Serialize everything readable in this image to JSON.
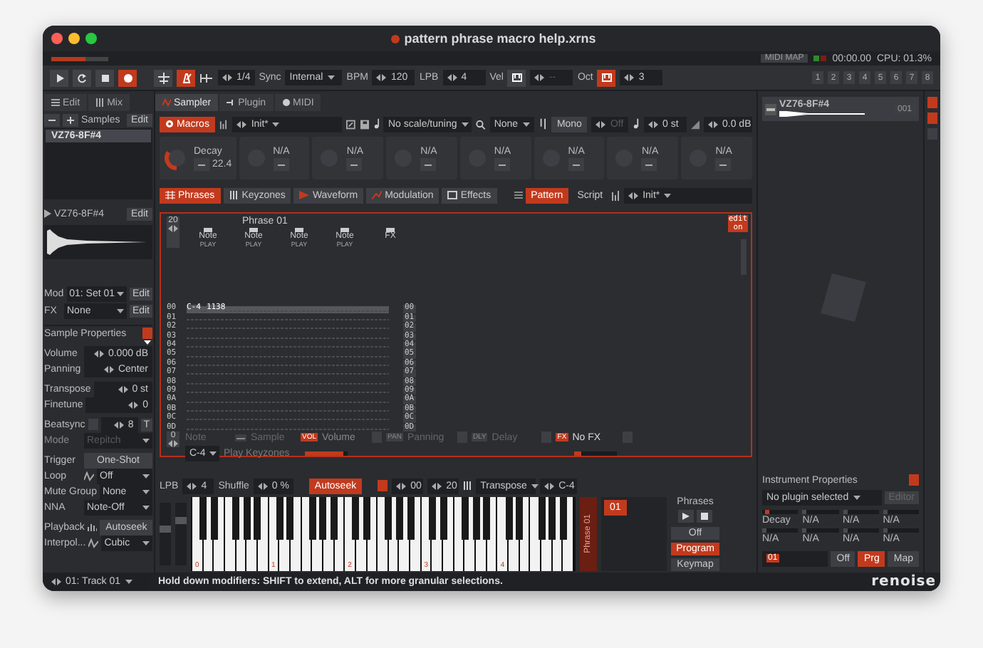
{
  "window": {
    "title": "pattern phrase macro help.xrns"
  },
  "top_status": {
    "midi_map": "MIDI MAP",
    "time": "00:00.00",
    "cpu": "CPU: 01.3%"
  },
  "transport": {
    "buttons": [
      {
        "kind": "play",
        "on": false
      },
      {
        "kind": "loop",
        "on": false
      },
      {
        "kind": "stop",
        "on": false
      },
      {
        "kind": "record",
        "on": true
      }
    ],
    "toggles": [
      {
        "kind": "follow",
        "on": false
      },
      {
        "kind": "metronome",
        "on": true
      }
    ],
    "step": "1/4",
    "sync": {
      "label": "Sync",
      "value": "Internal"
    },
    "bpm": {
      "label": "BPM",
      "value": "120"
    },
    "lpb": {
      "label": "LPB",
      "value": "4"
    },
    "velocity": {
      "label": "Vel",
      "value": "--",
      "on": false
    },
    "octave": {
      "label": "Oct",
      "value": "3",
      "on": true
    },
    "tracks": [
      "1",
      "2",
      "3",
      "4",
      "5",
      "6",
      "7",
      "8"
    ]
  },
  "left_tabs": [
    {
      "label": "Edit",
      "selected": false
    },
    {
      "label": "Mix",
      "selected": false
    }
  ],
  "samples": {
    "title": "Samples",
    "edit": "Edit",
    "items": [
      {
        "label": "VZ76-8F#4",
        "selected": true
      }
    ]
  },
  "sample_view": {
    "name": "VZ76-8F#4",
    "edit": "Edit"
  },
  "mod": {
    "label": "Mod",
    "value": "01: Set 01",
    "edit": "Edit"
  },
  "fx": {
    "label": "FX",
    "value": "None",
    "edit": "Edit"
  },
  "sample_properties": {
    "title": "Sample Properties",
    "groups": [
      [
        {
          "label": "Volume",
          "value": "0.000 dB",
          "kind": "stepper",
          "disabled": false
        },
        {
          "label": "Panning",
          "value": "Center",
          "kind": "stepper",
          "disabled": false
        }
      ],
      [
        {
          "label": "Transpose",
          "value": "0 st",
          "kind": "stepper",
          "disabled": false
        },
        {
          "label": "Finetune",
          "value": "0",
          "kind": "stepper",
          "disabled": false
        }
      ],
      [
        {
          "label": "Beatsync",
          "value": "8",
          "kind": "beatsync",
          "suffix": "T",
          "disabled": false
        },
        {
          "label": "Mode",
          "value": "Repitch",
          "kind": "dropdown",
          "disabled": true
        }
      ],
      [
        {
          "label": "Trigger",
          "value": "One-Shot",
          "kind": "button",
          "disabled": false
        },
        {
          "label": "Loop",
          "value": "Off",
          "kind": "icon-dropdown",
          "disabled": false
        },
        {
          "label": "Mute Group",
          "value": "None",
          "kind": "dropdown",
          "disabled": false
        },
        {
          "label": "NNA",
          "value": "Note-Off",
          "kind": "dropdown",
          "disabled": false
        }
      ],
      [
        {
          "label": "Playback",
          "value": "Autoseek",
          "kind": "icon-button",
          "disabled": false
        },
        {
          "label": "Interpol...",
          "value": "Cubic",
          "kind": "icon-dropdown",
          "disabled": false
        }
      ]
    ]
  },
  "instrument_tabs": [
    {
      "label": "Sampler",
      "selected": true
    },
    {
      "label": "Plugin",
      "selected": false
    },
    {
      "label": "MIDI",
      "selected": false
    }
  ],
  "sampler_toolbar": {
    "macros": {
      "label": "Macros",
      "on": true
    },
    "preset": "Init*",
    "scale": "No scale/tuning",
    "key": "None",
    "mono": "Mono",
    "glide": "Off",
    "transpose": "0 st",
    "volume": "0.0 dB"
  },
  "macros": [
    {
      "name": "Decay",
      "value": "22.4",
      "level": 0.35
    },
    {
      "name": "N/A"
    },
    {
      "name": "N/A"
    },
    {
      "name": "N/A"
    },
    {
      "name": "N/A"
    },
    {
      "name": "N/A"
    },
    {
      "name": "N/A"
    },
    {
      "name": "N/A"
    }
  ],
  "sampler_tabs": [
    {
      "label": "Phrases",
      "selected": true
    },
    {
      "label": "Keyzones",
      "selected": false
    },
    {
      "label": "Waveform",
      "selected": false
    },
    {
      "label": "Modulation",
      "selected": false
    },
    {
      "label": "Effects",
      "selected": false
    }
  ],
  "phrase_mode": [
    {
      "label": "Pattern",
      "selected": true
    },
    {
      "label": "Script",
      "selected": false
    }
  ],
  "phrase_preset": "Init*",
  "phrase_editor": {
    "lines": "20",
    "title": "Phrase 01",
    "edit_badge": "edit on",
    "columns": [
      {
        "name": "Note",
        "sub": "PLAY"
      },
      {
        "name": "Note",
        "sub": "PLAY"
      },
      {
        "name": "Note",
        "sub": "PLAY"
      },
      {
        "name": "Note",
        "sub": "PLAY"
      },
      {
        "name": "FX"
      }
    ],
    "rows": [
      {
        "line": "00",
        "line_end": "00",
        "note": "C-4",
        "value": "1138",
        "selected": true
      },
      {
        "line": "01",
        "line_end": "01",
        "selected": false
      },
      {
        "line": "02",
        "line_end": "02",
        "selected": false
      },
      {
        "line": "03",
        "line_end": "03",
        "selected": false
      },
      {
        "line": "04",
        "line_end": "04",
        "selected": false
      },
      {
        "line": "05",
        "line_end": "05",
        "selected": false
      },
      {
        "line": "06",
        "line_end": "06",
        "selected": false
      },
      {
        "line": "07",
        "line_end": "07",
        "selected": false
      },
      {
        "line": "08",
        "line_end": "08",
        "selected": false
      },
      {
        "line": "09",
        "line_end": "09",
        "selected": false
      },
      {
        "line": "0A",
        "line_end": "0A",
        "selected": false
      },
      {
        "line": "0B",
        "line_end": "0B",
        "selected": false
      },
      {
        "line": "0C",
        "line_end": "0C",
        "selected": false
      },
      {
        "line": "0D",
        "line_end": "0D",
        "selected": false
      }
    ],
    "step": "0",
    "column_controls": [
      {
        "kind": "plain",
        "label": "Note",
        "on": false
      },
      {
        "kind": "icon",
        "label": "Sample",
        "on": false
      },
      {
        "kind": "tag",
        "tag": "VOL",
        "label": "Volume",
        "on": true
      },
      {
        "kind": "tag",
        "tag": "PAN",
        "label": "Panning",
        "on": false
      },
      {
        "kind": "tag",
        "tag": "DLY",
        "label": "Delay",
        "on": false
      },
      {
        "kind": "tag",
        "tag": "FX",
        "label": "No FX",
        "on": true
      }
    ],
    "key": "C-4",
    "play_keyzones": "Play Keyzones",
    "volume_slider": {
      "level": 0.9
    },
    "fx_slider": {
      "level": 0.15
    }
  },
  "keyboard_bar": {
    "lpb": {
      "label": "LPB",
      "value": "4"
    },
    "shuffle": {
      "label": "Shuffle",
      "value": "0 %"
    },
    "autoseek": {
      "label": "Autoseek",
      "on": true
    },
    "loop_start": "00",
    "loop_end": "20",
    "transpose": "Transpose",
    "base_note": "C-4"
  },
  "keyboard": {
    "octaves": [
      "0",
      "1",
      "2",
      "3",
      "4"
    ],
    "sliders": [
      {
        "level": 0.6
      },
      {
        "level": 0.75
      }
    ]
  },
  "phrases": {
    "bar_label": "Phrase 01",
    "items": [
      {
        "label": "01",
        "selected": true
      }
    ],
    "title": "Phrases",
    "modes": [
      {
        "label": "Off",
        "selected": false
      },
      {
        "label": "Program",
        "selected": true
      },
      {
        "label": "Keymap",
        "selected": false
      }
    ]
  },
  "instrument": {
    "name": "VZ76-8F#4",
    "number": "001"
  },
  "instrument_properties": {
    "title": "Instrument Properties",
    "plugin": "No plugin selected",
    "editor": "Editor",
    "macros": [
      {
        "name": "Decay",
        "level": 0.1
      },
      {
        "name": "N/A",
        "level": 0
      },
      {
        "name": "N/A",
        "level": 0
      },
      {
        "name": "N/A",
        "level": 0
      },
      {
        "name": "N/A",
        "level": 0
      },
      {
        "name": "N/A",
        "level": 0
      },
      {
        "name": "N/A",
        "level": 0
      },
      {
        "name": "N/A",
        "level": 0
      }
    ],
    "phrase": "01",
    "modes": [
      {
        "label": "Off",
        "selected": false
      },
      {
        "label": "Prg",
        "selected": true
      },
      {
        "label": "Map",
        "selected": false
      }
    ]
  },
  "logo": "renoise",
  "status_bar": {
    "track": "01: Track 01",
    "message": "Hold down modifiers: SHIFT to extend, ALT for more granular selections."
  }
}
